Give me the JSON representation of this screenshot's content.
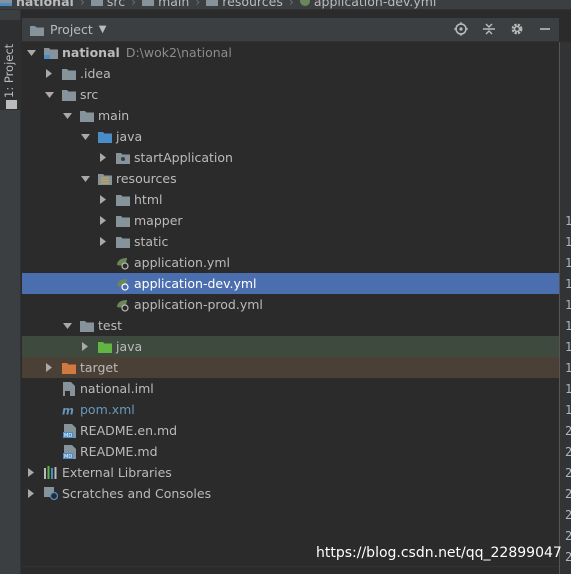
{
  "breadcrumb": {
    "items": [
      {
        "label": "national",
        "bold": true
      },
      {
        "label": "src"
      },
      {
        "label": "main"
      },
      {
        "label": "resources"
      },
      {
        "label": "application-dev.yml"
      }
    ]
  },
  "tool_stripe": {
    "label": "1: Project"
  },
  "panel": {
    "title": "Project"
  },
  "tree": {
    "project_name": "national",
    "project_path": "D:\\wok2\\national",
    "items": [
      {
        "label": "national"
      },
      {
        "label": ".idea"
      },
      {
        "label": "src"
      },
      {
        "label": "main"
      },
      {
        "label": "java"
      },
      {
        "label": "startApplication"
      },
      {
        "label": "resources"
      },
      {
        "label": "html"
      },
      {
        "label": "mapper"
      },
      {
        "label": "static"
      },
      {
        "label": "application.yml"
      },
      {
        "label": "application-dev.yml"
      },
      {
        "label": "application-prod.yml"
      },
      {
        "label": "test"
      },
      {
        "label": "java"
      },
      {
        "label": "target"
      },
      {
        "label": "national.iml"
      },
      {
        "label": "pom.xml"
      },
      {
        "label": "README.en.md"
      },
      {
        "label": "README.md"
      },
      {
        "label": "External Libraries"
      },
      {
        "label": "Scratches and Consoles"
      }
    ]
  },
  "gutter_numbers": [
    "1",
    "1",
    "1",
    "1",
    "1",
    "1",
    "1",
    "1",
    "1",
    "1",
    "2",
    "2",
    "2",
    "2",
    "2",
    "2",
    "2"
  ],
  "watermark": "https://blog.csdn.net/qq_22899047",
  "colors": {
    "background": "#2b2b2b",
    "panel": "#3c3f41",
    "selection": "#4b6eaf",
    "folder": "#87939a",
    "source_folder": "#4a8cc7",
    "test_folder": "#62b543",
    "excluded_folder": "#d17a3f",
    "yaml_leaf": "#6a8759"
  }
}
